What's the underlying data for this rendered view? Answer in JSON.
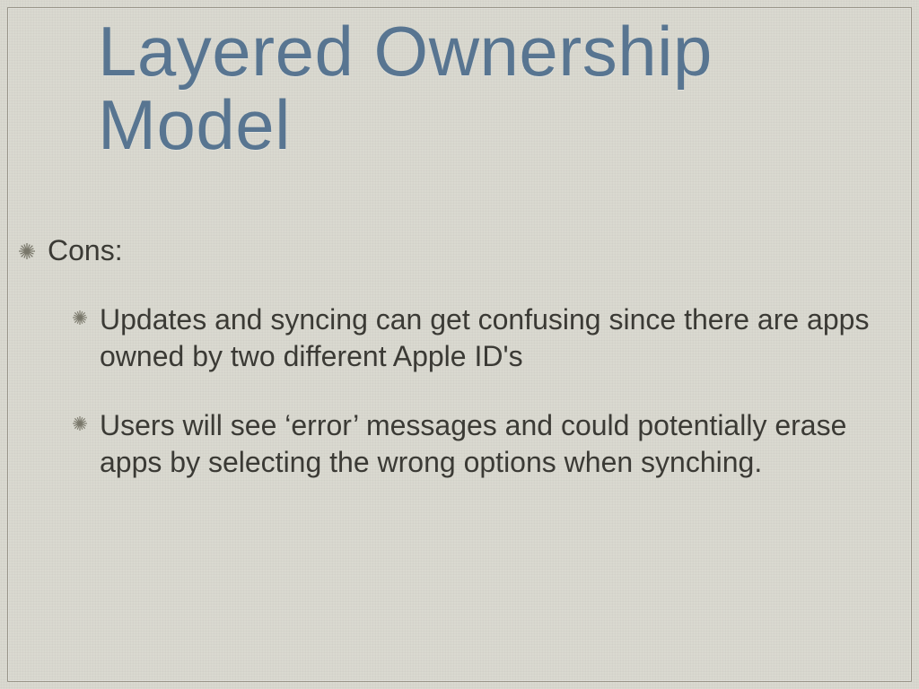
{
  "title": "Layered Ownership Model",
  "colors": {
    "title": "#587591",
    "text": "#3b3a35",
    "bullet": "#79776a",
    "background": "#d9d8cf"
  },
  "bullets": {
    "level1": [
      {
        "text": "Cons:"
      }
    ],
    "level2": [
      {
        "text": "Updates and syncing can get confusing since there are apps owned by two different Apple ID's"
      },
      {
        "text": "Users will see ‘error’ messages and could potentially erase apps by selecting the wrong options when synching."
      }
    ]
  }
}
